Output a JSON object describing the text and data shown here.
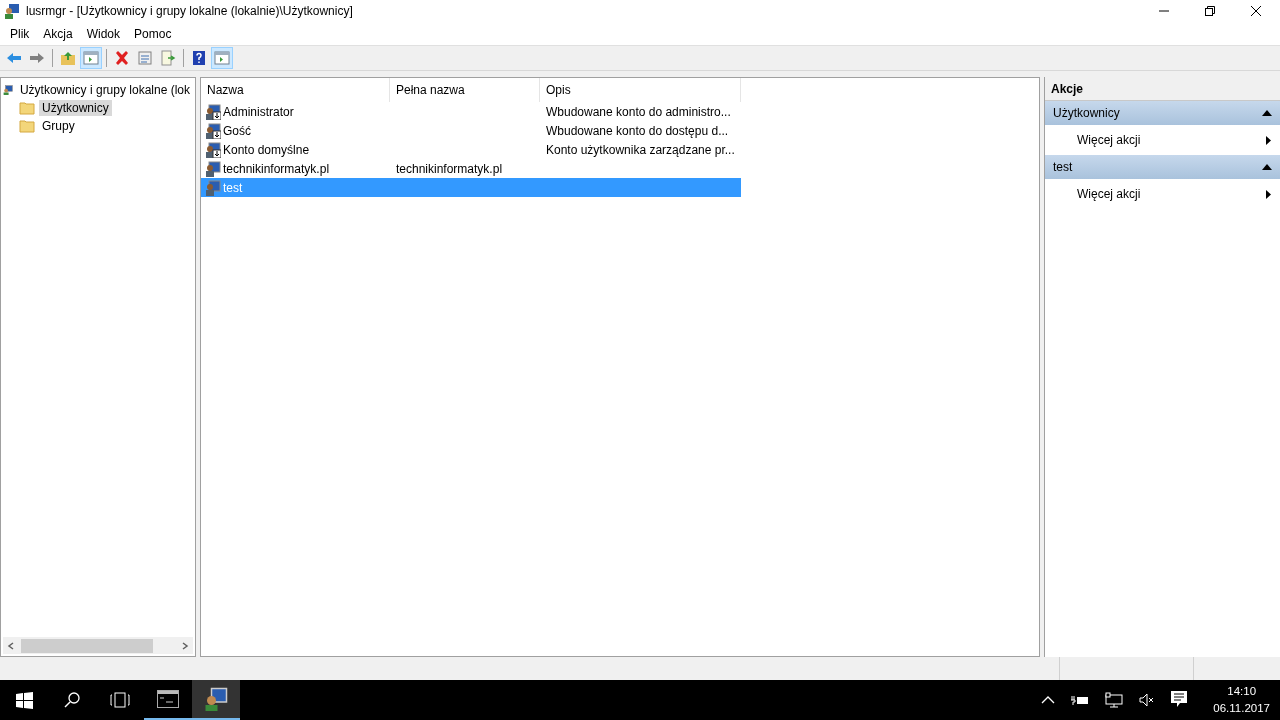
{
  "window": {
    "title": "lusrmgr - [Użytkownicy i grupy lokalne (lokalnie)\\Użytkownicy]"
  },
  "menu": [
    "Plik",
    "Akcja",
    "Widok",
    "Pomoc"
  ],
  "toolbar": [
    [
      {
        "kind": "back",
        "on": false
      },
      {
        "kind": "forward",
        "on": false
      }
    ],
    [
      {
        "kind": "up",
        "on": false
      },
      {
        "kind": "tree",
        "on": true
      }
    ],
    [
      {
        "kind": "delete",
        "on": false
      },
      {
        "kind": "properties",
        "on": false
      },
      {
        "kind": "export",
        "on": false
      }
    ],
    [
      {
        "kind": "help",
        "on": false
      },
      {
        "kind": "actionpane",
        "on": true
      }
    ]
  ],
  "tree": {
    "label": "Użytkownicy i grupy lokalne (lok",
    "children": [
      {
        "label": "Użytkownicy",
        "selected": true
      },
      {
        "label": "Grupy",
        "selected": false
      }
    ]
  },
  "table": {
    "columns": [
      "Nazwa",
      "Pełna nazwa",
      "Opis"
    ],
    "rows": [
      {
        "name": "Administrator",
        "description": "Wbudowane konto do administro...",
        "disabled": true,
        "selected": false
      },
      {
        "name": "Gość",
        "description": "Wbudowane konto do dostępu d...",
        "disabled": true,
        "selected": false
      },
      {
        "name": "Konto domyślne",
        "description": "Konto użytkownika zarządzane pr...",
        "disabled": true,
        "selected": false
      },
      {
        "name": "technikinformatyk.pl",
        "full_name": "technikinformatyk.pl",
        "disabled": false,
        "selected": false
      },
      {
        "name": "test",
        "disabled": false,
        "selected": true
      }
    ]
  },
  "actions": {
    "title": "Akcje",
    "sections": [
      {
        "title": "Użytkownicy",
        "items": [
          "Więcej akcji"
        ]
      },
      {
        "title": "test",
        "items": [
          "Więcej akcji"
        ]
      }
    ]
  },
  "taskbar": {
    "apps": [
      {
        "kind": "console",
        "active": false
      },
      {
        "kind": "users",
        "active": true
      }
    ],
    "time": "14:10",
    "date": "06.11.2017"
  }
}
